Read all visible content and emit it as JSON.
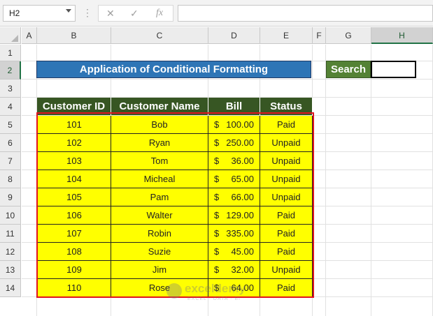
{
  "formula_bar": {
    "name_box": "H2",
    "dots": "⋮",
    "cancel_icon": "✕",
    "enter_icon": "✓",
    "fx_label": "fx",
    "formula": ""
  },
  "columns": [
    "A",
    "B",
    "C",
    "D",
    "E",
    "F",
    "G",
    "H"
  ],
  "selected_column": "H",
  "rows": [
    "1",
    "2",
    "3",
    "4",
    "5",
    "6",
    "7",
    "8",
    "9",
    "10",
    "11",
    "12",
    "13",
    "14"
  ],
  "selected_row": "2",
  "title": "Application of Conditional Formatting",
  "search": {
    "label": "Search",
    "value": ""
  },
  "table": {
    "headers": [
      "Customer ID",
      "Customer Name",
      "Bill",
      "Status"
    ],
    "rows": [
      {
        "id": "101",
        "name": "Bob",
        "currency": "$",
        "bill": "100.00",
        "status": "Paid"
      },
      {
        "id": "102",
        "name": "Ryan",
        "currency": "$",
        "bill": "250.00",
        "status": "Unpaid"
      },
      {
        "id": "103",
        "name": "Tom",
        "currency": "$",
        "bill": "36.00",
        "status": "Unpaid"
      },
      {
        "id": "104",
        "name": "Micheal",
        "currency": "$",
        "bill": "65.00",
        "status": "Unpaid"
      },
      {
        "id": "105",
        "name": "Pam",
        "currency": "$",
        "bill": "66.00",
        "status": "Unpaid"
      },
      {
        "id": "106",
        "name": "Walter",
        "currency": "$",
        "bill": "129.00",
        "status": "Paid"
      },
      {
        "id": "107",
        "name": "Robin",
        "currency": "$",
        "bill": "335.00",
        "status": "Paid"
      },
      {
        "id": "108",
        "name": "Suzie",
        "currency": "$",
        "bill": "45.00",
        "status": "Paid"
      },
      {
        "id": "109",
        "name": "Jim",
        "currency": "$",
        "bill": "32.00",
        "status": "Unpaid"
      },
      {
        "id": "110",
        "name": "Rose",
        "currency": "$",
        "bill": "64.00",
        "status": "Paid"
      }
    ]
  },
  "watermark": {
    "name": "exceldemy",
    "tagline": "EXCEL · DATA · BI"
  },
  "colors": {
    "title_bg": "#2e75b6",
    "search_bg": "#548235",
    "header_bg": "#375623",
    "highlight": "#ffff00",
    "outline": "#e0141e"
  }
}
